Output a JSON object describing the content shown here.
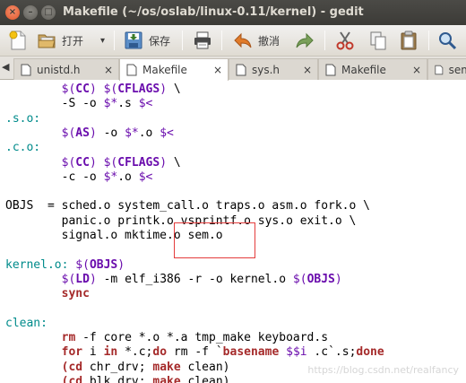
{
  "window": {
    "title": "Makefile (~/os/oslab/linux-0.11/kernel) - gedit",
    "close_glyph": "×",
    "min_glyph": "–",
    "max_glyph": "□"
  },
  "toolbar": {
    "open_label": "打开",
    "save_label": "保存",
    "undo_label": "撤消",
    "dropdown_glyph": "▾"
  },
  "tabs": [
    {
      "label": "unistd.h",
      "icon": "file-icon",
      "close": "×"
    },
    {
      "label": "Makefile",
      "icon": "file-icon",
      "close": "×"
    },
    {
      "label": "sys.h",
      "icon": "file-icon",
      "close": "×"
    },
    {
      "label": "Makefile",
      "icon": "file-icon",
      "close": "×"
    },
    {
      "label": "sem",
      "icon": "file-icon",
      "close": ""
    }
  ],
  "tabs_scroll_glyph": "◀",
  "editor": {
    "lines": [
      "\t$(CC) $(CFLAGS) \\",
      "\t-S -o $*.s $<",
      ".s.o:",
      "\t$(AS) -o $*.o $<",
      ".c.o:",
      "\t$(CC) $(CFLAGS) \\",
      "\t-c -o $*.o $<",
      "",
      "OBJS  = sched.o system_call.o traps.o asm.o fork.o \\",
      "\tpanic.o printk.o vsprintf.o sys.o exit.o \\",
      "\tsignal.o mktime.o sem.o",
      "",
      "kernel.o: $(OBJS)",
      "\t$(LD) -m elf_i386 -r -o kernel.o $(OBJS)",
      "\tsync",
      "",
      "clean:",
      "\trm -f core *.o *.a tmp_make keyboard.s",
      "\tfor i in *.c;do rm -f `basename $$i .c`.s;done",
      "\t(cd chr_drv; make clean)",
      "\t(cd blk_drv; make clean)"
    ]
  },
  "watermark": "https://blog.csdn.net/realfancy",
  "colors": {
    "titlebar": "#3c3b37",
    "close_button": "#e0562a",
    "highlight_box": "#e43c3c",
    "keyword": "#a52a2a",
    "variable": "#6a0dad",
    "target": "#008b8b"
  }
}
